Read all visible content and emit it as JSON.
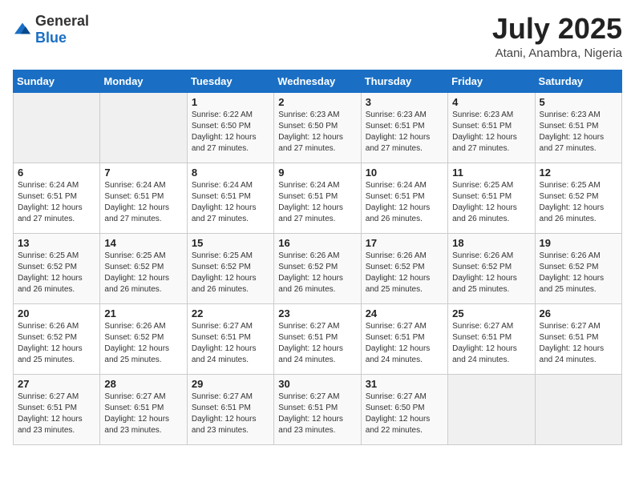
{
  "header": {
    "logo": {
      "general": "General",
      "blue": "Blue"
    },
    "month": "July 2025",
    "location": "Atani, Anambra, Nigeria"
  },
  "weekdays": [
    "Sunday",
    "Monday",
    "Tuesday",
    "Wednesday",
    "Thursday",
    "Friday",
    "Saturday"
  ],
  "weeks": [
    [
      {
        "day": "",
        "empty": true
      },
      {
        "day": "",
        "empty": true
      },
      {
        "day": "1",
        "sunrise": "Sunrise: 6:22 AM",
        "sunset": "Sunset: 6:50 PM",
        "daylight": "Daylight: 12 hours and 27 minutes."
      },
      {
        "day": "2",
        "sunrise": "Sunrise: 6:23 AM",
        "sunset": "Sunset: 6:50 PM",
        "daylight": "Daylight: 12 hours and 27 minutes."
      },
      {
        "day": "3",
        "sunrise": "Sunrise: 6:23 AM",
        "sunset": "Sunset: 6:51 PM",
        "daylight": "Daylight: 12 hours and 27 minutes."
      },
      {
        "day": "4",
        "sunrise": "Sunrise: 6:23 AM",
        "sunset": "Sunset: 6:51 PM",
        "daylight": "Daylight: 12 hours and 27 minutes."
      },
      {
        "day": "5",
        "sunrise": "Sunrise: 6:23 AM",
        "sunset": "Sunset: 6:51 PM",
        "daylight": "Daylight: 12 hours and 27 minutes."
      }
    ],
    [
      {
        "day": "6",
        "sunrise": "Sunrise: 6:24 AM",
        "sunset": "Sunset: 6:51 PM",
        "daylight": "Daylight: 12 hours and 27 minutes."
      },
      {
        "day": "7",
        "sunrise": "Sunrise: 6:24 AM",
        "sunset": "Sunset: 6:51 PM",
        "daylight": "Daylight: 12 hours and 27 minutes."
      },
      {
        "day": "8",
        "sunrise": "Sunrise: 6:24 AM",
        "sunset": "Sunset: 6:51 PM",
        "daylight": "Daylight: 12 hours and 27 minutes."
      },
      {
        "day": "9",
        "sunrise": "Sunrise: 6:24 AM",
        "sunset": "Sunset: 6:51 PM",
        "daylight": "Daylight: 12 hours and 27 minutes."
      },
      {
        "day": "10",
        "sunrise": "Sunrise: 6:24 AM",
        "sunset": "Sunset: 6:51 PM",
        "daylight": "Daylight: 12 hours and 26 minutes."
      },
      {
        "day": "11",
        "sunrise": "Sunrise: 6:25 AM",
        "sunset": "Sunset: 6:51 PM",
        "daylight": "Daylight: 12 hours and 26 minutes."
      },
      {
        "day": "12",
        "sunrise": "Sunrise: 6:25 AM",
        "sunset": "Sunset: 6:52 PM",
        "daylight": "Daylight: 12 hours and 26 minutes."
      }
    ],
    [
      {
        "day": "13",
        "sunrise": "Sunrise: 6:25 AM",
        "sunset": "Sunset: 6:52 PM",
        "daylight": "Daylight: 12 hours and 26 minutes."
      },
      {
        "day": "14",
        "sunrise": "Sunrise: 6:25 AM",
        "sunset": "Sunset: 6:52 PM",
        "daylight": "Daylight: 12 hours and 26 minutes."
      },
      {
        "day": "15",
        "sunrise": "Sunrise: 6:25 AM",
        "sunset": "Sunset: 6:52 PM",
        "daylight": "Daylight: 12 hours and 26 minutes."
      },
      {
        "day": "16",
        "sunrise": "Sunrise: 6:26 AM",
        "sunset": "Sunset: 6:52 PM",
        "daylight": "Daylight: 12 hours and 26 minutes."
      },
      {
        "day": "17",
        "sunrise": "Sunrise: 6:26 AM",
        "sunset": "Sunset: 6:52 PM",
        "daylight": "Daylight: 12 hours and 25 minutes."
      },
      {
        "day": "18",
        "sunrise": "Sunrise: 6:26 AM",
        "sunset": "Sunset: 6:52 PM",
        "daylight": "Daylight: 12 hours and 25 minutes."
      },
      {
        "day": "19",
        "sunrise": "Sunrise: 6:26 AM",
        "sunset": "Sunset: 6:52 PM",
        "daylight": "Daylight: 12 hours and 25 minutes."
      }
    ],
    [
      {
        "day": "20",
        "sunrise": "Sunrise: 6:26 AM",
        "sunset": "Sunset: 6:52 PM",
        "daylight": "Daylight: 12 hours and 25 minutes."
      },
      {
        "day": "21",
        "sunrise": "Sunrise: 6:26 AM",
        "sunset": "Sunset: 6:52 PM",
        "daylight": "Daylight: 12 hours and 25 minutes."
      },
      {
        "day": "22",
        "sunrise": "Sunrise: 6:27 AM",
        "sunset": "Sunset: 6:51 PM",
        "daylight": "Daylight: 12 hours and 24 minutes."
      },
      {
        "day": "23",
        "sunrise": "Sunrise: 6:27 AM",
        "sunset": "Sunset: 6:51 PM",
        "daylight": "Daylight: 12 hours and 24 minutes."
      },
      {
        "day": "24",
        "sunrise": "Sunrise: 6:27 AM",
        "sunset": "Sunset: 6:51 PM",
        "daylight": "Daylight: 12 hours and 24 minutes."
      },
      {
        "day": "25",
        "sunrise": "Sunrise: 6:27 AM",
        "sunset": "Sunset: 6:51 PM",
        "daylight": "Daylight: 12 hours and 24 minutes."
      },
      {
        "day": "26",
        "sunrise": "Sunrise: 6:27 AM",
        "sunset": "Sunset: 6:51 PM",
        "daylight": "Daylight: 12 hours and 24 minutes."
      }
    ],
    [
      {
        "day": "27",
        "sunrise": "Sunrise: 6:27 AM",
        "sunset": "Sunset: 6:51 PM",
        "daylight": "Daylight: 12 hours and 23 minutes."
      },
      {
        "day": "28",
        "sunrise": "Sunrise: 6:27 AM",
        "sunset": "Sunset: 6:51 PM",
        "daylight": "Daylight: 12 hours and 23 minutes."
      },
      {
        "day": "29",
        "sunrise": "Sunrise: 6:27 AM",
        "sunset": "Sunset: 6:51 PM",
        "daylight": "Daylight: 12 hours and 23 minutes."
      },
      {
        "day": "30",
        "sunrise": "Sunrise: 6:27 AM",
        "sunset": "Sunset: 6:51 PM",
        "daylight": "Daylight: 12 hours and 23 minutes."
      },
      {
        "day": "31",
        "sunrise": "Sunrise: 6:27 AM",
        "sunset": "Sunset: 6:50 PM",
        "daylight": "Daylight: 12 hours and 22 minutes."
      },
      {
        "day": "",
        "empty": true
      },
      {
        "day": "",
        "empty": true
      }
    ]
  ]
}
